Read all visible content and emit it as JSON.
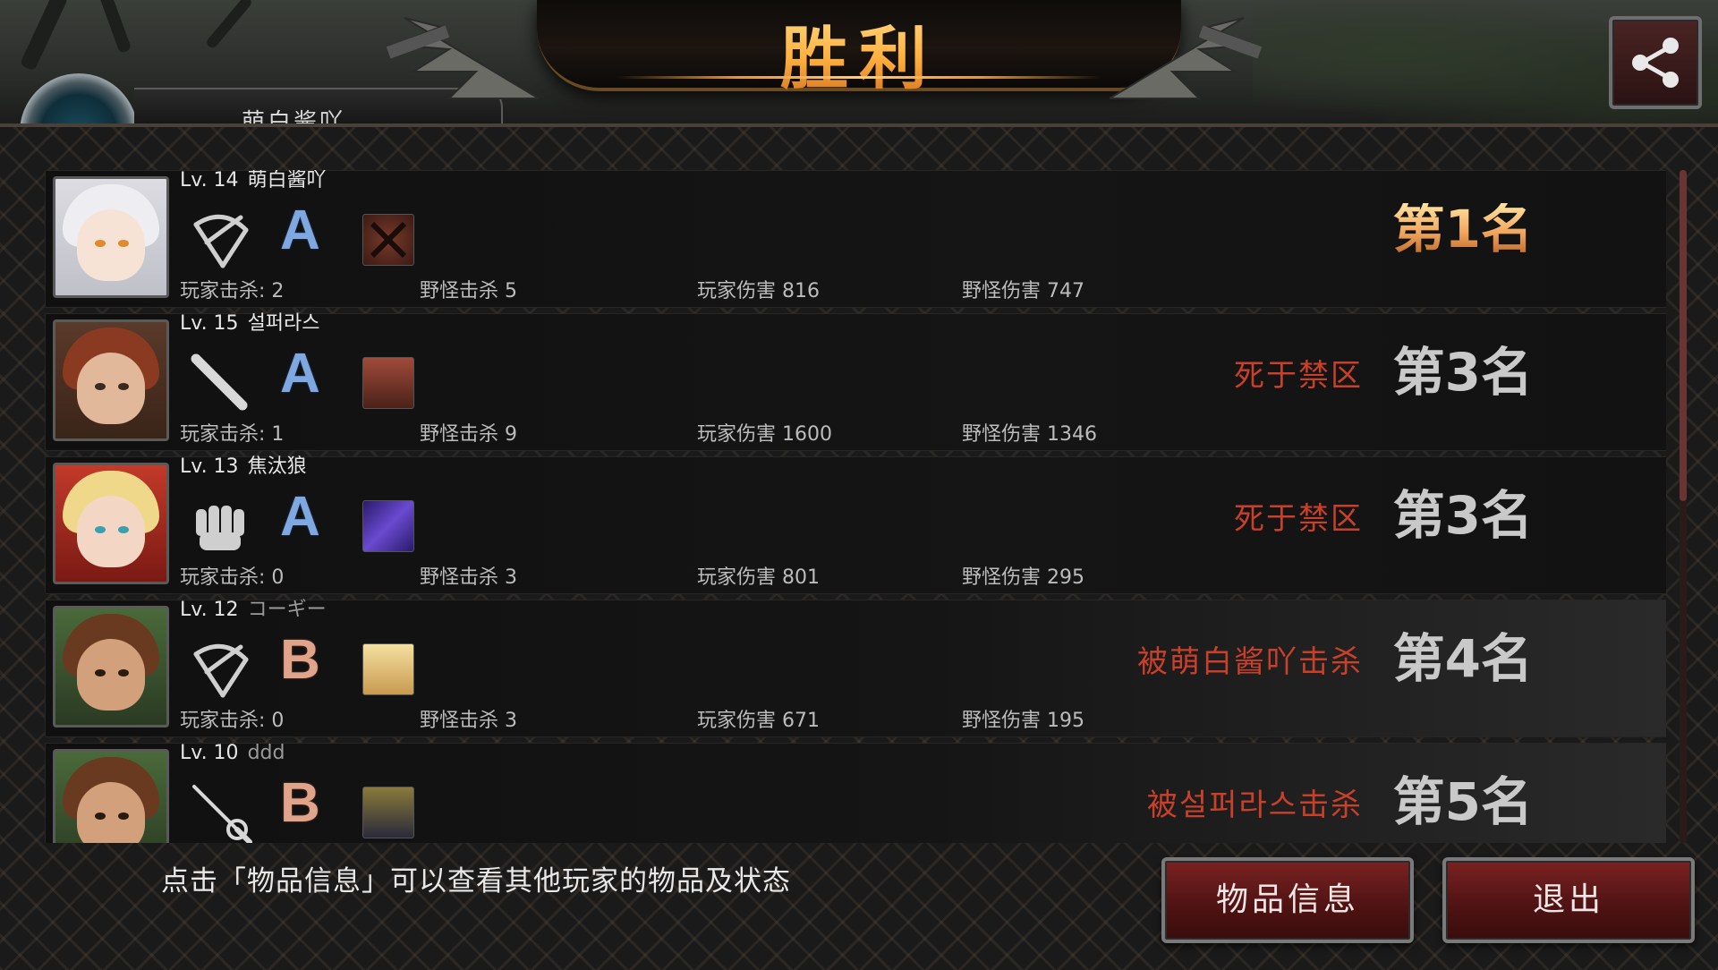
{
  "header": {
    "title": "胜利",
    "player_name": "萌白酱吖",
    "share_icon": "share-icon"
  },
  "results": [
    {
      "level": "Lv. 14",
      "name": "萌白酱吖",
      "weapon_icon": "crossbow-icon",
      "grade": "A",
      "item_icon": "crossed-blades-item-icon",
      "player_kills": "玩家击杀: 2",
      "monster_kills": "野怪击杀 5",
      "player_damage": "玩家伤害 816",
      "monster_damage": "野怪伤害 747",
      "death": "",
      "rank": "第1名"
    },
    {
      "level": "Lv. 15",
      "name": "설퍼라스",
      "weapon_icon": "baseball-bat-icon",
      "grade": "A",
      "item_icon": "binoculars-character-item-icon",
      "player_kills": "玩家击杀: 1",
      "monster_kills": "野怪击杀 9",
      "player_damage": "玩家伤害 1600",
      "monster_damage": "野怪伤害 1346",
      "death": "死于禁区",
      "rank": "第3名"
    },
    {
      "level": "Lv. 13",
      "name": "焦汰狼",
      "weapon_icon": "fist-icon",
      "grade": "A",
      "item_icon": "purple-crystal-item-icon",
      "player_kills": "玩家击杀: 0",
      "monster_kills": "野怪击杀 3",
      "player_damage": "玩家伤害 801",
      "monster_damage": "野怪伤害 295",
      "death": "死于禁区",
      "rank": "第3名"
    },
    {
      "level": "Lv. 12",
      "name": "コーギー",
      "weapon_icon": "crossbow-icon",
      "grade": "B",
      "item_icon": "bread-item-icon",
      "player_kills": "玩家击杀: 0",
      "monster_kills": "野怪击杀 3",
      "player_damage": "玩家伤害 671",
      "monster_damage": "野怪伤害 195",
      "death": "被萌白酱吖击杀",
      "rank": "第4名"
    },
    {
      "level": "Lv. 10",
      "name": "ddd",
      "weapon_icon": "rapier-icon",
      "grade": "B",
      "item_icon": "ninja-character-item-icon",
      "player_kills": "",
      "monster_kills": "",
      "player_damage": "",
      "monster_damage": "",
      "death": "被설퍼라스击杀",
      "rank": "第5名"
    }
  ],
  "footer": {
    "hint": "点击「物品信息」可以查看其他玩家的物品及状态",
    "items_button": "物品信息",
    "exit_button": "退出"
  },
  "colors": {
    "title_gold": "#ffb24a",
    "death_red": "#c8402a",
    "grade_a": "#7fa8e0",
    "grade_b": "#e0a48a",
    "button_red": "#5a1616"
  }
}
